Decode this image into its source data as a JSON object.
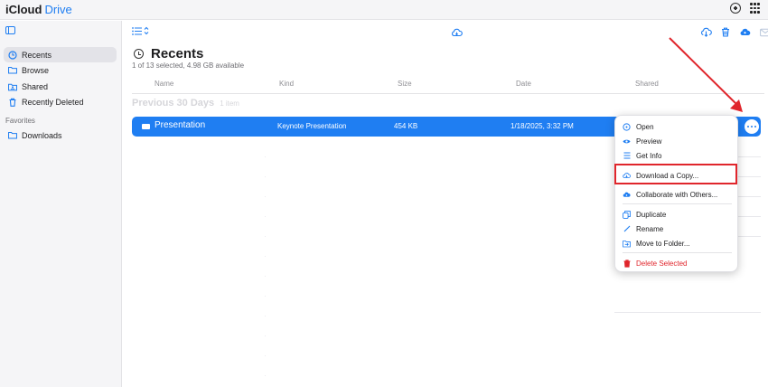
{
  "app": {
    "brand_icloud": "iCloud",
    "brand_drive": "Drive"
  },
  "sidebar": {
    "items": [
      {
        "label": "Recents",
        "icon": "clock-icon"
      },
      {
        "label": "Browse",
        "icon": "folder-icon"
      },
      {
        "label": "Shared",
        "icon": "shared-folder-icon"
      },
      {
        "label": "Recently Deleted",
        "icon": "trash-icon"
      }
    ],
    "favorites_heading": "Favorites",
    "favorites": [
      {
        "label": "Downloads",
        "icon": "folder-icon"
      }
    ]
  },
  "main": {
    "title": "Recents",
    "subtitle": "1 of 13 selected, 4.98 GB available",
    "columns": [
      "Name",
      "Kind",
      "Size",
      "Date",
      "Shared"
    ],
    "section_label": "Previous 30 Days",
    "section_count": "1 item",
    "selected_file": {
      "name": "Presentation",
      "kind": "Keynote Presentation",
      "size": "454 KB",
      "date": "1/18/2025, 3:32 PM"
    }
  },
  "context_menu": {
    "items": [
      {
        "label": "Open",
        "icon": "open-icon"
      },
      {
        "label": "Preview",
        "icon": "eye-icon"
      },
      {
        "label": "Get Info",
        "icon": "list-icon"
      },
      {
        "label": "Download a Copy...",
        "icon": "cloud-download-icon"
      },
      {
        "label": "Collaborate with Others...",
        "icon": "collaborate-icon"
      },
      {
        "label": "Duplicate",
        "icon": "duplicate-icon"
      },
      {
        "label": "Rename",
        "icon": "pencil-icon"
      },
      {
        "label": "Move to Folder...",
        "icon": "move-folder-icon"
      },
      {
        "label": "Delete Selected",
        "icon": "trash-icon"
      }
    ]
  },
  "colors": {
    "accent": "#1f7ef2",
    "danger": "#e0262c",
    "sidebar_bg": "#f5f5f7"
  }
}
